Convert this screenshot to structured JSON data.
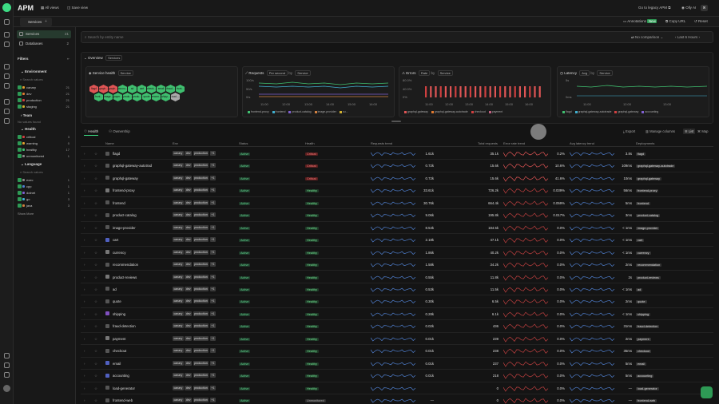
{
  "app": {
    "title": "APM",
    "all_views": "All views",
    "save_view": "Save view",
    "legacy": "Go to legacy APM",
    "user": "Olly AI",
    "user_badge": "⌘",
    "annotations": "Annotations",
    "annotations_badge": "New",
    "copy_url": "Copy URL",
    "reset": "Reset"
  },
  "tab": {
    "label": "Services"
  },
  "nav": [
    {
      "label": "Services",
      "count": "21"
    },
    {
      "label": "Databases",
      "count": "2"
    }
  ],
  "filters": {
    "title": "Filters",
    "environment": {
      "label": "Environment",
      "search": "Search values",
      "values": [
        {
          "label": "canary",
          "count": "21",
          "color": "#e0a030"
        },
        {
          "label": "dev",
          "count": "21",
          "color": "#e07a30"
        },
        {
          "label": "production",
          "count": "21",
          "color": "#d04040"
        },
        {
          "label": "staging",
          "count": "21",
          "color": "#d0b030"
        }
      ]
    },
    "team": {
      "label": "Team",
      "empty": "No values found"
    },
    "health": {
      "label": "Health",
      "values": [
        {
          "label": "critical",
          "count": "3",
          "color": "#d04040"
        },
        {
          "label": "warning",
          "count": "0",
          "color": "#e0a030"
        },
        {
          "label": "healthy",
          "count": "17",
          "color": "#40c070"
        },
        {
          "label": "unmonitored",
          "count": "1",
          "color": "#888888"
        }
      ]
    },
    "language": {
      "label": "Language",
      "search": "Search values",
      "values": [
        {
          "label": "exec",
          "count": "1",
          "color": "#888888"
        },
        {
          "label": "cpp",
          "count": "1",
          "color": "#5080d0"
        },
        {
          "label": "dotnet",
          "count": "1",
          "color": "#8060d0"
        },
        {
          "label": "go",
          "count": "3",
          "color": "#40b0d0"
        },
        {
          "label": "java",
          "count": "3",
          "color": "#d08040"
        }
      ],
      "show_more": "Show More"
    }
  },
  "search": {
    "placeholder": "Search by entity name",
    "comparison": "No comparison",
    "range": "Last 6 Hours"
  },
  "overview": {
    "label": "Overview",
    "badge": "Services"
  },
  "cards": {
    "health": {
      "title": "Service health",
      "group": "Service",
      "hexes": [
        {
          "label": "flagd",
          "color": "#e05555"
        },
        {
          "label": "graph...",
          "color": "#e05555"
        },
        {
          "label": "graph...",
          "color": "#e05555"
        },
        {
          "label": "accou...",
          "color": "#3fbf6f"
        },
        {
          "label": "ad",
          "color": "#3fbf6f"
        },
        {
          "label": "cart",
          "color": "#3fbf6f"
        },
        {
          "label": "check...",
          "color": "#3fbf6f"
        },
        {
          "label": "email",
          "color": "#3fbf6f"
        },
        {
          "label": "fraud...",
          "color": "#3fbf6f"
        },
        {
          "label": "front...",
          "color": "#3fbf6f"
        },
        {
          "label": "front...",
          "color": "#3fbf6f"
        },
        {
          "label": "image...",
          "color": "#3fbf6f"
        },
        {
          "label": "paym...",
          "color": "#3fbf6f"
        },
        {
          "label": "produ...",
          "color": "#3fbf6f"
        },
        {
          "label": "produ...",
          "color": "#3fbf6f"
        },
        {
          "label": "quote",
          "color": "#3fbf6f"
        },
        {
          "label": "recom...",
          "color": "#3fbf6f"
        },
        {
          "label": "shipp...",
          "color": "#3fbf6f"
        },
        {
          "label": "load-...",
          "color": "#aaaaaa"
        }
      ]
    },
    "requests": {
      "title": "Requests",
      "metric": "Per second",
      "by": "by",
      "group": "Service",
      "yticks": [
        "100/s",
        "50/s",
        "0/s"
      ],
      "xticks": [
        "11:00",
        "12:00",
        "13:00",
        "14:00",
        "15:00",
        "16:00"
      ],
      "legend": [
        "frontend-proxy",
        "frontend",
        "product-catalog",
        "image-provider",
        "cu..."
      ]
    },
    "errors": {
      "title": "Errors",
      "metric": "Rate",
      "by": "by",
      "group": "Service",
      "yticks": [
        "80.0%",
        "40.0%",
        "0%"
      ],
      "xticks": [
        "11:00",
        "12:00",
        "13:00",
        "14:00",
        "15:00",
        "16:00"
      ],
      "legend": [
        "graphql-gateway",
        "graphql-gateway-autotrade",
        "checkout",
        "payment"
      ]
    },
    "latency": {
      "title": "Latency",
      "metric": "Avg",
      "by": "by",
      "group": "Service",
      "yticks": [
        "5s",
        "0ms"
      ],
      "xticks": [
        "11:00",
        "12:00",
        "13:00"
      ],
      "legend": [
        "flagd",
        "graphql-gateway-autotrade",
        "graphql-gateway",
        "accounting"
      ]
    }
  },
  "subtabs": {
    "health": "Health",
    "ownership": "Ownership",
    "export": "Export",
    "manage": "Manage columns",
    "list": "List",
    "map": "Map"
  },
  "table": {
    "headers": {
      "name": "Name",
      "env": "Env",
      "status": "Status",
      "health": "Health",
      "req_trend": "Requests trend",
      "total": "Total requests",
      "err_trend": "Error rate trend",
      "latency": "Avg latency trend",
      "deploy": "Deployments"
    },
    "env_tags": [
      "canary",
      "dev",
      "production",
      "+1"
    ],
    "rows": [
      {
        "name": "flagd",
        "status": "Active",
        "health": "Critical",
        "hclass": "critical",
        "req": "1.61k",
        "total": "35.1k",
        "err": "0.2%",
        "lat": "3.8s",
        "dep": "flagd",
        "ico": "#555"
      },
      {
        "name": "graphql-gateway-autotrad",
        "status": "Active",
        "health": "Critical",
        "hclass": "critical",
        "req": "0.72k",
        "total": "15.6k",
        "err": "10.6%",
        "lat": "109ms",
        "dep": "graphql-gateway-autotrade",
        "ico": "#555"
      },
      {
        "name": "graphql-gateway",
        "status": "Active",
        "health": "Critical",
        "hclass": "critical",
        "req": "0.72k",
        "total": "15.6k",
        "err": "41.6%",
        "lat": "10ms",
        "dep": "graphql-gateway",
        "ico": "#555"
      },
      {
        "name": "frontend-proxy",
        "status": "Active",
        "health": "Healthy",
        "hclass": "healthy",
        "req": "33.61k",
        "total": "726.2k",
        "err": "0.039%",
        "lat": "56ms",
        "dep": "frontend-proxy",
        "ico": "#777"
      },
      {
        "name": "frontend",
        "status": "Active",
        "health": "Healthy",
        "hclass": "healthy",
        "req": "30.76k",
        "total": "664.4k",
        "err": "0.059%",
        "lat": "5ms",
        "dep": "frontend",
        "ico": "#555"
      },
      {
        "name": "product-catalog",
        "status": "Active",
        "health": "Healthy",
        "hclass": "healthy",
        "req": "9.06k",
        "total": "195.8k",
        "err": "0.017%",
        "lat": "3ms",
        "dep": "product-catalog",
        "ico": "#555"
      },
      {
        "name": "image-provider",
        "status": "Active",
        "health": "Healthy",
        "hclass": "healthy",
        "req": "8.54k",
        "total": "184.5k",
        "err": "0.0%",
        "lat": "< 1ms",
        "dep": "image-provider",
        "ico": "#555"
      },
      {
        "name": "cart",
        "status": "Active",
        "health": "Healthy",
        "hclass": "healthy",
        "req": "2.18k",
        "total": "47.1k",
        "err": "0.0%",
        "lat": "< 1ms",
        "dep": "cart",
        "ico": "#5060c0"
      },
      {
        "name": "currency",
        "status": "Active",
        "health": "Healthy",
        "hclass": "healthy",
        "req": "1.86k",
        "total": "40.2k",
        "err": "0.0%",
        "lat": "< 1ms",
        "dep": "currency",
        "ico": "#777"
      },
      {
        "name": "recommendation",
        "status": "Active",
        "health": "Healthy",
        "hclass": "healthy",
        "req": "1.58k",
        "total": "34.2k",
        "err": "0.0%",
        "lat": "2ms",
        "dep": "recommendation",
        "ico": "#555"
      },
      {
        "name": "product-reviews",
        "status": "Active",
        "health": "Healthy",
        "hclass": "healthy",
        "req": "0.55k",
        "total": "11.8k",
        "err": "0.0%",
        "lat": "2s",
        "dep": "product-reviews",
        "ico": "#777"
      },
      {
        "name": "ad",
        "status": "Active",
        "health": "Healthy",
        "hclass": "healthy",
        "req": "0.53k",
        "total": "11.5k",
        "err": "0.0%",
        "lat": "< 1ms",
        "dep": "ad",
        "ico": "#555"
      },
      {
        "name": "quote",
        "status": "Active",
        "health": "Healthy",
        "hclass": "healthy",
        "req": "0.30k",
        "total": "6.5k",
        "err": "0.0%",
        "lat": "2ms",
        "dep": "quote",
        "ico": "#555"
      },
      {
        "name": "shipping",
        "status": "Active",
        "health": "Healthy",
        "hclass": "healthy",
        "req": "0.28k",
        "total": "6.1k",
        "err": "0.0%",
        "lat": "< 1ms",
        "dep": "shipping",
        "ico": "#8050c0"
      },
      {
        "name": "fraud-detection",
        "status": "Active",
        "health": "Healthy",
        "hclass": "healthy",
        "req": "0.02k",
        "total": "436",
        "err": "0.0%",
        "lat": "31ms",
        "dep": "fraud-detection",
        "ico": "#555"
      },
      {
        "name": "payment",
        "status": "Active",
        "health": "Healthy",
        "hclass": "healthy",
        "req": "0.01k",
        "total": "239",
        "err": "0.0%",
        "lat": "2ms",
        "dep": "payment",
        "ico": "#777"
      },
      {
        "name": "checkout",
        "status": "Active",
        "health": "Healthy",
        "hclass": "healthy",
        "req": "0.01k",
        "total": "238",
        "err": "0.0%",
        "lat": "35ms",
        "dep": "checkout",
        "ico": "#555"
      },
      {
        "name": "email",
        "status": "Active",
        "health": "Healthy",
        "hclass": "healthy",
        "req": "0.01k",
        "total": "237",
        "err": "0.0%",
        "lat": "5ms",
        "dep": "email",
        "ico": "#5060c0"
      },
      {
        "name": "accounting",
        "status": "Active",
        "health": "Healthy",
        "hclass": "healthy",
        "req": "0.01k",
        "total": "218",
        "err": "0.0%",
        "lat": "5ms",
        "dep": "accounting",
        "ico": "#5060c0"
      },
      {
        "name": "load-generator",
        "status": "Active",
        "health": "Healthy",
        "hclass": "healthy",
        "req": "",
        "total": "0",
        "err": "0.0%",
        "lat": "—",
        "dep": "load-generator",
        "ico": "#555"
      },
      {
        "name": "frontend-web",
        "status": "Active",
        "health": "Unmonitored",
        "hclass": "unmonitored",
        "req": "—",
        "total": "0",
        "err": "0.0%",
        "lat": "—",
        "dep": "frontend-web",
        "ico": "#555"
      }
    ]
  }
}
